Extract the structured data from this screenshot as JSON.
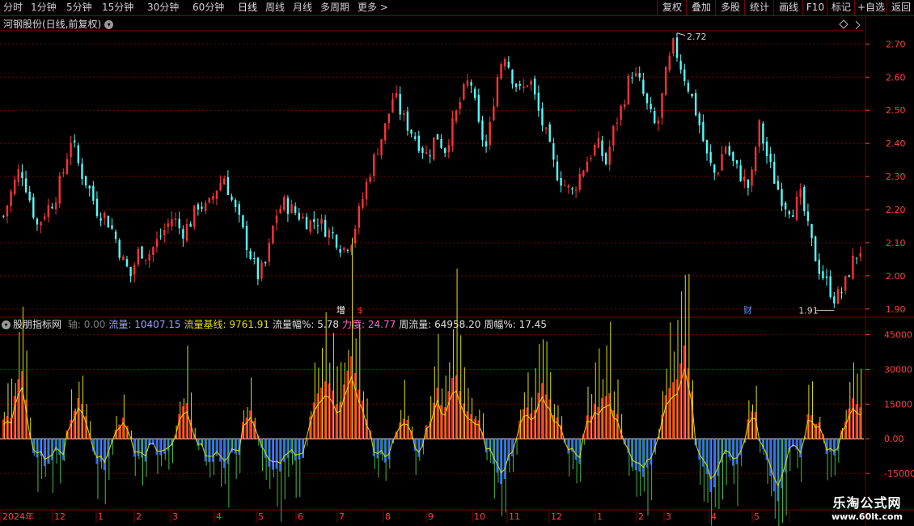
{
  "toolbar": {
    "left": [
      "分时",
      "1分钟",
      "5分钟",
      "15分钟",
      "30分钟",
      "60分钟",
      "日线",
      "周线",
      "月线",
      "多周期",
      "更多 >"
    ],
    "active": "日线",
    "right": [
      "复权",
      "叠加",
      "多股",
      "统计",
      "画线",
      "F10",
      "标记",
      "+自选",
      "返回"
    ]
  },
  "header": {
    "title": "河钢股份(日线,前复权)"
  },
  "indicator": {
    "name": "股朋指标网",
    "fields": [
      {
        "label": "轴:",
        "value": "0.00",
        "color": "#808080"
      },
      {
        "label": "流量:",
        "value": "10407.15",
        "color": "#a0a0ff"
      },
      {
        "label": "流量基线:",
        "value": "9761.91",
        "color": "#e0e000"
      },
      {
        "label": "流量幅%:",
        "value": "5.78",
        "color": "#e0e0e0"
      },
      {
        "label": "力度:",
        "value": "24.77",
        "color": "#ff66cc"
      },
      {
        "label": "周流量:",
        "value": "64958.20",
        "color": "#e0e0e0"
      },
      {
        "label": "周幅%:",
        "value": "17.45",
        "color": "#e0e0e0"
      }
    ]
  },
  "markers": {
    "zeng": "增",
    "s": "$",
    "cai": "财",
    "high": "2.72",
    "low": "1.91"
  },
  "axis": {
    "date_labels": [
      "2024年",
      "12",
      "1",
      "2",
      "3",
      "4",
      "5",
      "6",
      "7",
      "8",
      "9",
      "10",
      "11",
      "12",
      "1",
      "2",
      "3",
      "4",
      "5"
    ]
  },
  "logo": {
    "name": "乐淘公式网",
    "url": "www.60lt.com"
  },
  "colors": {
    "up": "#ff3232",
    "down": "#54fcfc",
    "grid": "#7a0000",
    "axis_text": "#ff4040"
  },
  "chart_data": [
    {
      "type": "candlestick",
      "title": "河钢股份(日线,前复权)",
      "y_ticks": [
        2.7,
        2.6,
        2.5,
        2.4,
        2.3,
        2.2,
        2.1,
        2.0,
        1.9
      ],
      "ylim": [
        1.88,
        2.74
      ],
      "annotations": [
        {
          "text": "2.72",
          "kind": "high"
        },
        {
          "text": "1.91",
          "kind": "low"
        }
      ],
      "close_path": [
        2.18,
        2.26,
        2.33,
        2.24,
        2.15,
        2.2,
        2.23,
        2.31,
        2.42,
        2.32,
        2.27,
        2.2,
        2.18,
        2.13,
        2.05,
        2.0,
        2.08,
        2.06,
        2.1,
        2.14,
        2.18,
        2.13,
        2.16,
        2.22,
        2.2,
        2.26,
        2.3,
        2.22,
        2.15,
        2.07,
        2.0,
        2.04,
        2.18,
        2.22,
        2.2,
        2.18,
        2.16,
        2.17,
        2.14,
        2.12,
        2.08,
        2.11,
        2.2,
        2.3,
        2.38,
        2.45,
        2.55,
        2.48,
        2.44,
        2.4,
        2.36,
        2.43,
        2.38,
        2.46,
        2.54,
        2.6,
        2.45,
        2.38,
        2.58,
        2.68,
        2.6,
        2.55,
        2.6,
        2.5,
        2.42,
        2.32,
        2.28,
        2.25,
        2.31,
        2.36,
        2.4,
        2.34,
        2.45,
        2.52,
        2.62,
        2.58,
        2.5,
        2.44,
        2.6,
        2.7,
        2.62,
        2.55,
        2.46,
        2.35,
        2.3,
        2.4,
        2.34,
        2.3,
        2.26,
        2.46,
        2.36,
        2.28,
        2.22,
        2.2,
        2.24,
        2.12,
        2.03,
        1.98,
        1.93,
        1.96,
        2.04,
        2.08
      ],
      "candle_count": 230
    },
    {
      "type": "bar",
      "title": "股朋指标网",
      "y_ticks": [
        45000,
        30000,
        15000,
        0.0,
        -15000
      ],
      "ylim": [
        -30000,
        48000
      ],
      "series": [
        {
          "name": "流量",
          "color_up": "#ff2020",
          "color_down": "#3060ff"
        },
        {
          "name": "流量基线",
          "color": "#e0e000"
        },
        {
          "name": "力度",
          "color_up": "#e0e000",
          "color_down": "#40c040"
        }
      ],
      "flow_path": [
        6000,
        9000,
        18000,
        32000,
        12000,
        -4000,
        -8000,
        -12000,
        -10000,
        -3000,
        -12000,
        8000,
        12000,
        22000,
        10000,
        -5000,
        -10000,
        -14000,
        -8000,
        5000,
        9000,
        6000,
        -4000,
        -8000,
        -12000,
        -2000,
        -6000,
        -10000,
        -3000,
        -4000,
        10000,
        20000,
        6000,
        -3000,
        -6000,
        -12000,
        -6000,
        -9000,
        -12000,
        -4000,
        -8000,
        8000,
        14000,
        4000,
        -6000,
        -10000,
        -12000,
        -18000,
        -8000,
        -4000,
        -8000,
        -6000,
        8000,
        14000,
        22000,
        28000,
        20000,
        12000,
        24000,
        36000,
        30000,
        16000,
        8000,
        -5000,
        -8000,
        -10000,
        -6000,
        5000,
        10000,
        6000,
        -4000,
        -8000,
        4000,
        12000,
        20000,
        12000,
        24000,
        30000,
        18000,
        14000,
        10000,
        6000,
        -3000,
        -8000,
        -14000,
        -20000,
        -12000,
        -6000,
        8000,
        14000,
        10000,
        18000,
        26000,
        16000,
        10000,
        6000,
        -4000,
        -8000,
        -12000,
        6000,
        10000,
        14000,
        18000,
        22000,
        12000,
        6000,
        -5000,
        -10000,
        -14000,
        -18000,
        -12000,
        -6000,
        8000,
        18000,
        22000,
        30000,
        42000,
        28000,
        -3000,
        -12000,
        -18000,
        -24000,
        -14000,
        -6000,
        -8000,
        -12000,
        -6000,
        8000,
        12000,
        -4000,
        -10000,
        -18000,
        -28000,
        -14000,
        -6000,
        -4000,
        -8000,
        8000,
        10000,
        6000,
        -4000,
        -8000,
        -6000,
        4000,
        12000,
        18000,
        14000
      ]
    }
  ]
}
